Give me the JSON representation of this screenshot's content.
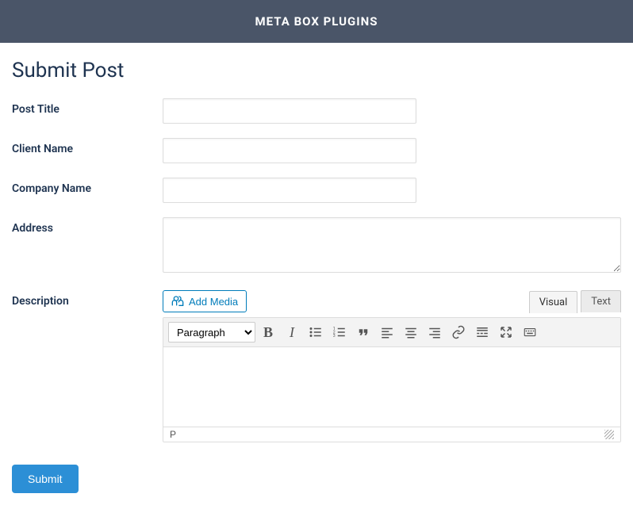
{
  "header": {
    "title": "META BOX PLUGINS"
  },
  "page": {
    "title": "Submit Post"
  },
  "fields": {
    "post_title": {
      "label": "Post Title",
      "value": ""
    },
    "client_name": {
      "label": "Client Name",
      "value": ""
    },
    "company_name": {
      "label": "Company Name",
      "value": ""
    },
    "address": {
      "label": "Address",
      "value": ""
    },
    "description": {
      "label": "Description"
    }
  },
  "editor": {
    "add_media_label": "Add Media",
    "tabs": {
      "visual": "Visual",
      "text": "Text",
      "active": "visual"
    },
    "format_select": "Paragraph",
    "status_path": "P"
  },
  "submit": {
    "label": "Submit"
  }
}
